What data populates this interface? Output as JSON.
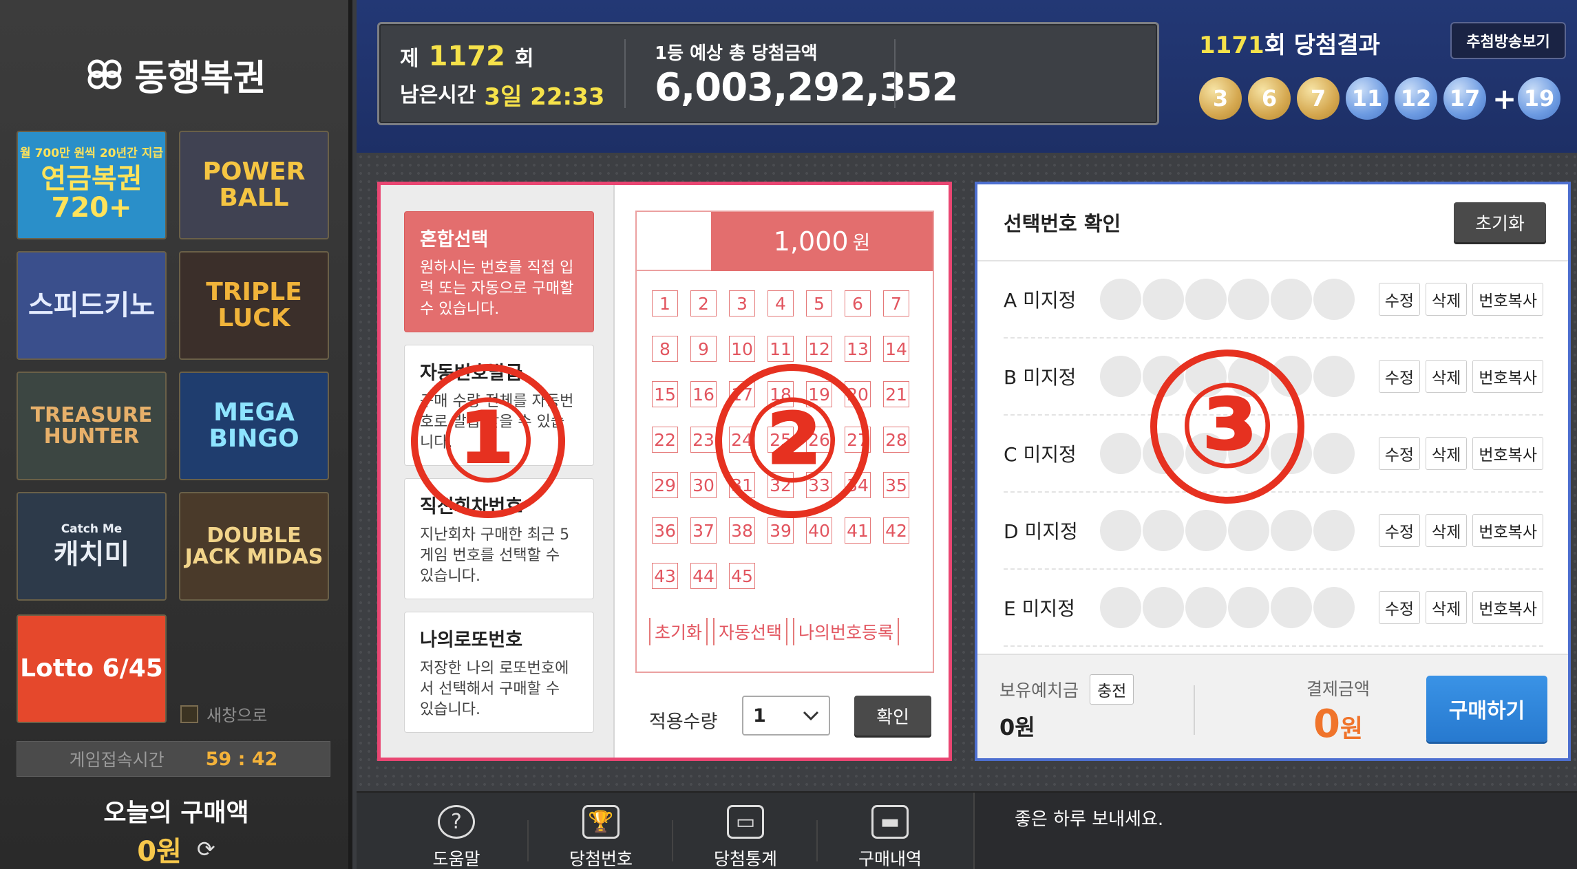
{
  "sidebar": {
    "brand": "동행복권",
    "games": [
      {
        "label": "연금복권720+",
        "sub": "월 700만 원씩 20년간 지급",
        "bg": "#2a8fc9",
        "fg": "#ffe35a"
      },
      {
        "label": "POWER BALL",
        "sub": "",
        "bg": "#404252",
        "fg": "#f5c542"
      },
      {
        "label": "스피드키노",
        "sub": "",
        "bg": "#3a4f8c",
        "fg": "#e4ecff"
      },
      {
        "label": "TRIPLE LUCK",
        "sub": "",
        "bg": "#3b2f2a",
        "fg": "#f1b43a"
      },
      {
        "label": "TREASURE HUNTER",
        "sub": "",
        "bg": "#3c4642",
        "fg": "#e7b06a"
      },
      {
        "label": "MEGA BINGO",
        "sub": "",
        "bg": "#1f3d6e",
        "fg": "#8ee4ff"
      },
      {
        "label": "캐치미",
        "sub": "Catch Me",
        "bg": "#2d3a4a",
        "fg": "#e9eef5"
      },
      {
        "label": "DOUBLE JACK MIDAS",
        "sub": "",
        "bg": "#4a3a2a",
        "fg": "#f2d48a"
      },
      {
        "label": "Lotto 6/45",
        "sub": "",
        "bg": "#e5482c",
        "fg": "#ffffff"
      }
    ],
    "new_window": "새창으로",
    "session_label": "게임접속시간",
    "session_time": "59 : 42",
    "today_label": "오늘의 구매액",
    "today_amount": "0원"
  },
  "header": {
    "draw_prefix": "제",
    "draw_no": "1172",
    "draw_suffix": "회",
    "remain_label": "남은시간",
    "remain_value": "3일 22:33",
    "prize_label": "1등 예상 총 당첨금액",
    "prize_value": "6,003,292,352",
    "result_no": "1171",
    "result_suffix": "회 당첨결과",
    "broadcast_btn": "추첨방송보기",
    "balls": [
      {
        "n": "3",
        "color": "gold"
      },
      {
        "n": "6",
        "color": "gold"
      },
      {
        "n": "7",
        "color": "gold"
      },
      {
        "n": "11",
        "color": "blue"
      },
      {
        "n": "12",
        "color": "blue"
      },
      {
        "n": "17",
        "color": "blue"
      }
    ],
    "plus": "+",
    "bonus": {
      "n": "19",
      "color": "blue"
    }
  },
  "options": [
    {
      "title": "혼합선택",
      "desc": "원하시는 번호를 직접 입력 또는 자동으로 구매할 수 있습니다.",
      "active": true
    },
    {
      "title": "자동번호발급",
      "desc": "구매 수량 전체를 자동번호로 발급 받을 수 있습니다.",
      "active": false
    },
    {
      "title": "직전회차번호",
      "desc": "지난회차 구매한 최근 5게임 번호를 선택할 수 있습니다.",
      "active": false
    },
    {
      "title": "나의로또번호",
      "desc": "저장한 나의 로또번호에서 선택해서 구매할 수 있습니다.",
      "active": false
    }
  ],
  "slip": {
    "price": "1,000",
    "unit": "원",
    "numbers": [
      "1",
      "2",
      "3",
      "4",
      "5",
      "6",
      "7",
      "8",
      "9",
      "10",
      "11",
      "12",
      "13",
      "14",
      "15",
      "16",
      "17",
      "18",
      "19",
      "20",
      "21",
      "22",
      "23",
      "24",
      "25",
      "26",
      "27",
      "28",
      "29",
      "30",
      "31",
      "32",
      "33",
      "34",
      "35",
      "36",
      "37",
      "38",
      "39",
      "40",
      "41",
      "42",
      "43",
      "44",
      "45"
    ],
    "buttons": [
      "초기화",
      "자동선택",
      "나의번호등록"
    ],
    "qty_label": "적용수량",
    "qty_value": "1",
    "ok": "확인"
  },
  "markers": [
    "①",
    "②",
    "③"
  ],
  "confirm": {
    "title": "선택번호 확인",
    "reset": "초기화",
    "rows": [
      {
        "label": "A 미지정"
      },
      {
        "label": "B 미지정"
      },
      {
        "label": "C 미지정"
      },
      {
        "label": "D 미지정"
      },
      {
        "label": "E 미지정"
      }
    ],
    "row_buttons": [
      "수정",
      "삭제",
      "번호복사"
    ],
    "deposit_label": "보유예치금",
    "charge": "충전",
    "deposit_value": "0원",
    "pay_label": "결제금액",
    "pay_value": "0",
    "pay_unit": "원",
    "buy": "구매하기"
  },
  "bottom": {
    "nav": [
      {
        "label": "도움말",
        "icon": "help-icon",
        "glyph": "?"
      },
      {
        "label": "당첨번호",
        "icon": "trophy-icon",
        "glyph": "🏆"
      },
      {
        "label": "당첨통계",
        "icon": "stats-board-icon",
        "glyph": "▭"
      },
      {
        "label": "구매내역",
        "icon": "card-icon",
        "glyph": "▬"
      }
    ],
    "message": "좋은 하루 보내세요."
  }
}
